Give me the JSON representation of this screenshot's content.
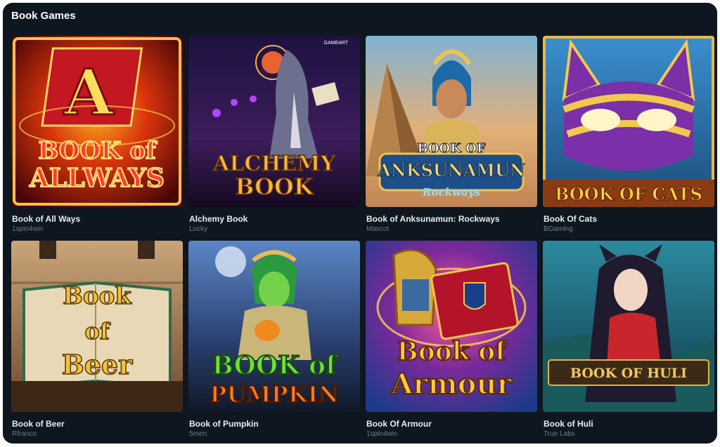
{
  "section": {
    "title": "Book Games"
  },
  "games": [
    {
      "name": "Book of All Ways",
      "provider": "1spin4win",
      "logo_lines": [
        "BOOK of",
        "ALLWAYS"
      ],
      "badge": "A"
    },
    {
      "name": "Alchemy Book",
      "provider": "Lucky",
      "logo_lines": [
        "ALCHEMY",
        "BOOK"
      ],
      "studio_tag": "GAMEART"
    },
    {
      "name": "Book of Anksunamun: Rockways",
      "provider": "Mascot",
      "logo_lines": [
        "BOOK OF",
        "ANKSUNAMUN",
        "Rockways"
      ]
    },
    {
      "name": "Book Of Cats",
      "provider": "BGaming",
      "logo_lines": [
        "BOOK OF CATS"
      ]
    },
    {
      "name": "Book of Beer",
      "provider": "Rfranco",
      "logo_lines": [
        "Book",
        "of",
        "Beer"
      ]
    },
    {
      "name": "Book of Pumpkin",
      "provider": "5men",
      "logo_lines": [
        "BOOK of",
        "PUMPKIN"
      ]
    },
    {
      "name": "Book Of Armour",
      "provider": "1spin4win",
      "logo_lines": [
        "Book of",
        "Armour"
      ]
    },
    {
      "name": "Book of Huli",
      "provider": "True Labs",
      "logo_lines": [
        "BOOK OF HULI"
      ]
    }
  ]
}
